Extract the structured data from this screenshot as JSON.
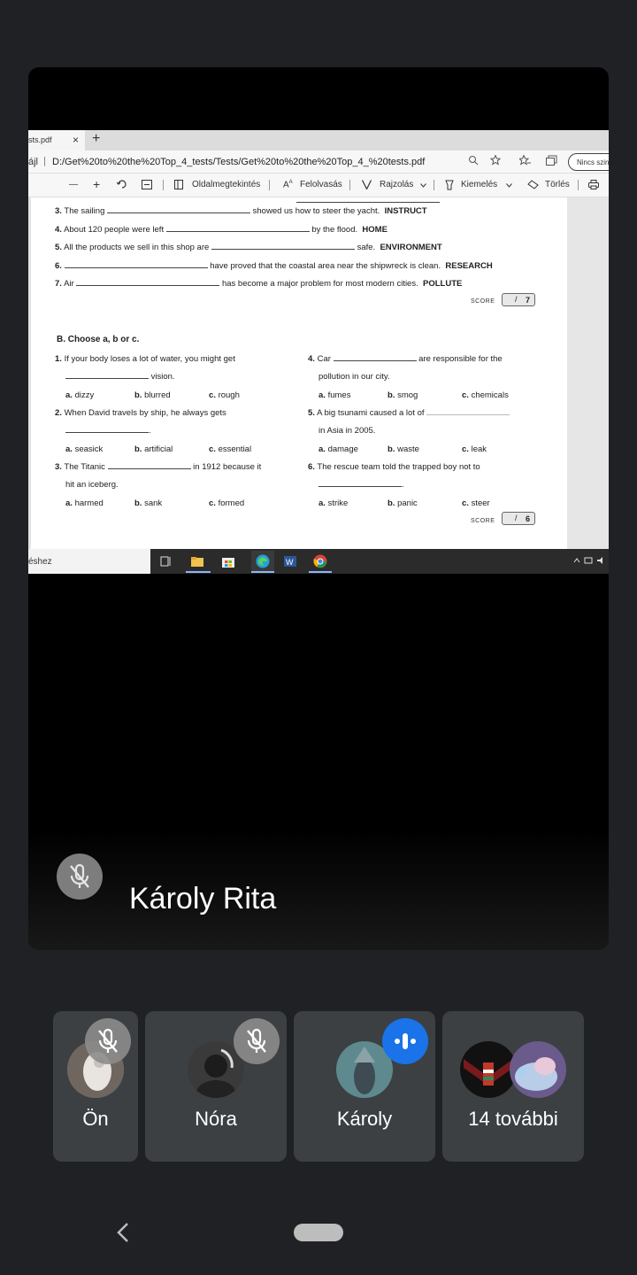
{
  "browser": {
    "tab_title": "sts.pdf",
    "tab_close": "×",
    "new_tab": "+",
    "address_prefix": "ájl",
    "url": "D:/Get%20to%20the%20Top_4_tests/Tests/Get%20to%20the%20Top_4_%20tests.pdf",
    "profile_label": "Nincs szin"
  },
  "pdf_toolbar": {
    "zoom_out": "—",
    "zoom_in": "+",
    "page_view": "Oldalmegtekintés",
    "read_aloud": "Felolvasás",
    "draw": "Rajzolás",
    "highlight": "Kiemelés",
    "erase": "Törlés"
  },
  "worksheet": {
    "section_a": [
      {
        "num": "3.",
        "before": "The sailing",
        "after": "showed us how to steer the yacht.",
        "keyword": "INSTRUCT"
      },
      {
        "num": "4.",
        "before": "About 120 people were left",
        "after": "by the flood.",
        "keyword": "HOME"
      },
      {
        "num": "5.",
        "before": "All the products we sell in this shop are",
        "after": "safe.",
        "keyword": "ENVIRONMENT"
      },
      {
        "num": "6.",
        "before": "",
        "after": "have proved that the coastal area near the shipwreck is clean.",
        "keyword": "RESEARCH"
      },
      {
        "num": "7.",
        "before": "Air",
        "after": "has become a major problem for most modern cities.",
        "keyword": "POLLUTE"
      }
    ],
    "score_label": "SCORE",
    "score_a": "7",
    "section_b_title": "B. Choose a, b or c.",
    "section_b": [
      {
        "num": "1.",
        "line1": "If your body loses a lot of water, you might get",
        "line2": "vision.",
        "a": "dizzy",
        "b": "blurred",
        "c": "rough"
      },
      {
        "num": "2.",
        "line1": "When David travels by ship, he always gets",
        "line2": ".",
        "a": "seasick",
        "b": "artificial",
        "c": "essential"
      },
      {
        "num": "3.",
        "line1a": "The Titanic",
        "line1b": "in 1912 because it",
        "line2": "hit an iceberg.",
        "a": "harmed",
        "b": "sank",
        "c": "formed"
      },
      {
        "num": "4.",
        "line1a": "Car",
        "line1b": "are responsible for the",
        "line2": "pollution in our city.",
        "a": "fumes",
        "b": "smog",
        "c": "chemicals"
      },
      {
        "num": "5.",
        "line1": "A big tsunami caused a lot of",
        "line2": "in Asia in 2005.",
        "a": "damage",
        "b": "waste",
        "c": "leak"
      },
      {
        "num": "6.",
        "line1": "The rescue team told the trapped boy not to",
        "line2": ".",
        "a": "strike",
        "b": "panic",
        "c": "steer"
      }
    ],
    "score_b": "6",
    "option_letters": {
      "a": "a.",
      "b": "b.",
      "c": "c."
    }
  },
  "taskbar": {
    "search_text": "éshez"
  },
  "meeting": {
    "presenter_name": "Károly Rita",
    "participants": [
      {
        "name": "Ön",
        "state": "muted"
      },
      {
        "name": "Nóra",
        "state": "muted"
      },
      {
        "name": "Károly",
        "state": "speaking"
      },
      {
        "name": "14 további",
        "state": "more"
      }
    ]
  },
  "colors": {
    "meet_background": "#202124",
    "tile_background": "#3c4043",
    "speaking_blue": "#1a73e8"
  }
}
